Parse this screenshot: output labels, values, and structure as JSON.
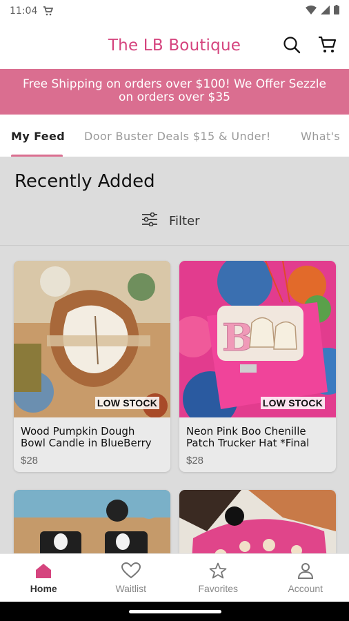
{
  "status": {
    "time": "11:04"
  },
  "header": {
    "title": "The LB Boutique"
  },
  "promo": {
    "line1": "Free Shipping on orders over $100! We Offer Sezzle",
    "line2": "on orders over $35"
  },
  "tabs": [
    {
      "label": "My Feed"
    },
    {
      "label": "Door Buster Deals $15 & Under!"
    },
    {
      "label": "What's"
    }
  ],
  "section": {
    "title": "Recently Added",
    "filter_label": "Filter"
  },
  "products": [
    {
      "name_line1": "Wood Pumpkin Dough",
      "name_line2": "Bowl Candle in BlueBerry",
      "price": "$28",
      "badge": "LOW STOCK"
    },
    {
      "name_line1": "Neon Pink Boo Chenille",
      "name_line2": "Patch Trucker Hat *Final",
      "price": "$28",
      "badge": "LOW STOCK"
    }
  ],
  "nav": [
    {
      "label": "Home"
    },
    {
      "label": "Waitlist"
    },
    {
      "label": "Favorites"
    },
    {
      "label": "Account"
    }
  ],
  "colors": {
    "brand_pink": "#d5447e",
    "promo_bg": "#da6e90"
  }
}
